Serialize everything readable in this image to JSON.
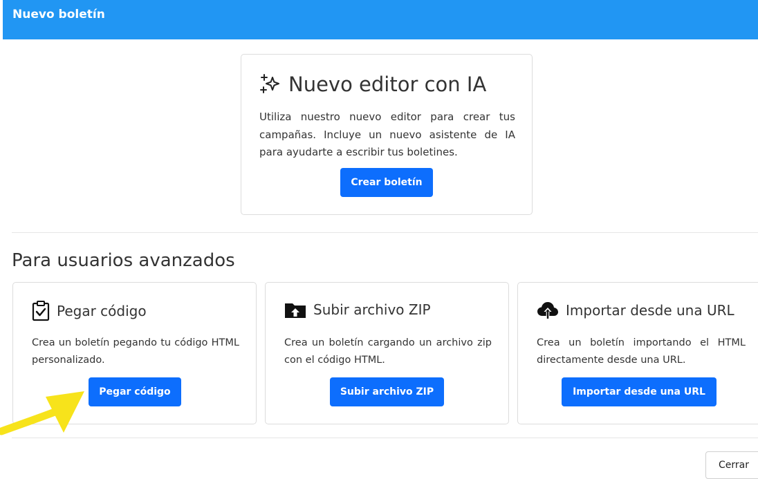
{
  "header": {
    "title": "Nuevo boletín",
    "color": "#2196f3"
  },
  "ai_card": {
    "title": "Nuevo editor con IA",
    "icon": "sparkles-icon",
    "description": "Utiliza nuestro nuevo editor para crear tus campañas. Incluye un nuevo asistente de IA para ayudarte a escribir tus boletines.",
    "button_label": "Crear boletín"
  },
  "advanced": {
    "title": "Para usuarios avanzados",
    "cards": [
      {
        "title": "Pegar código",
        "icon": "clipboard-check-icon",
        "description": "Crea un boletín pegando tu código HTML personalizado.",
        "button_label": "Pegar código"
      },
      {
        "title": "Subir archivo ZIP",
        "icon": "folder-upload-icon",
        "description": "Crea un boletín cargando un archivo zip con el código HTML.",
        "button_label": "Subir archivo ZIP"
      },
      {
        "title": "Importar desde una URL",
        "icon": "cloud-upload-icon",
        "description": "Crea un boletín importando el HTML directamente desde una URL.",
        "button_label": "Importar desde una URL"
      }
    ]
  },
  "footer": {
    "close_label": "Cerrar"
  },
  "annotation": {
    "type": "yellow-arrow-pointer",
    "color": "#f7e31b"
  },
  "colors": {
    "primary_button": "#0d6efd"
  }
}
